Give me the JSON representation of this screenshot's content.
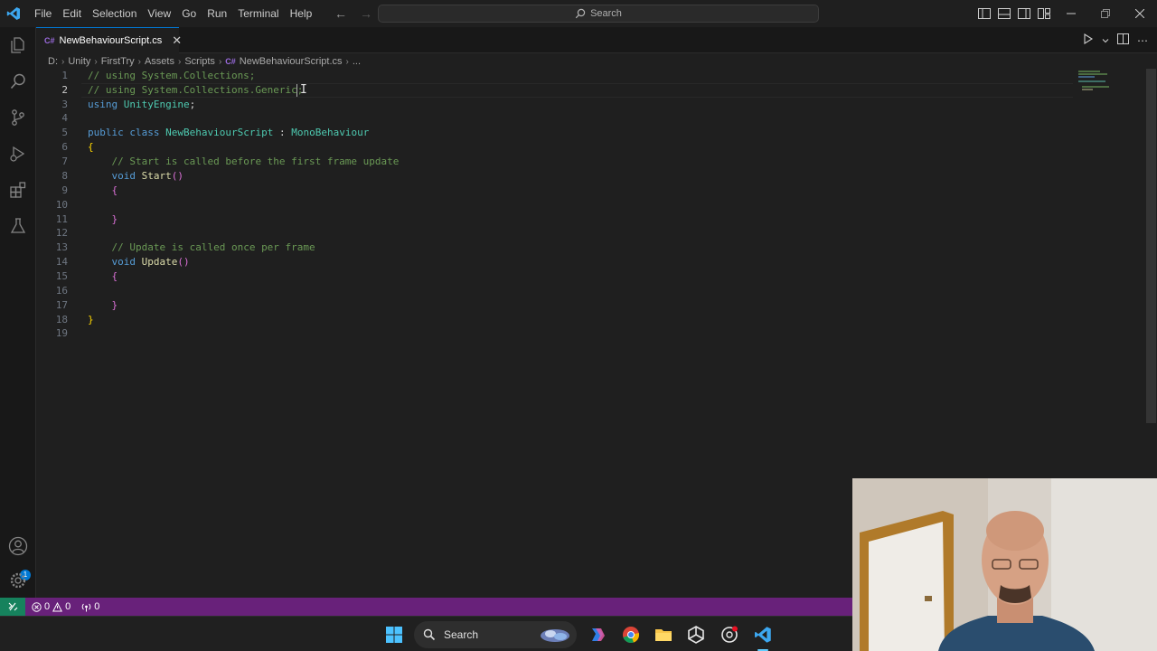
{
  "menu": [
    "File",
    "Edit",
    "Selection",
    "View",
    "Go",
    "Run",
    "Terminal",
    "Help"
  ],
  "command_center": {
    "placeholder": "Search"
  },
  "tab": {
    "lang": "C#",
    "label": "NewBehaviourScript.cs"
  },
  "breadcrumb": {
    "items": [
      "D:",
      "Unity",
      "FirstTry",
      "Assets",
      "Scripts"
    ],
    "file_lang": "C#",
    "file": "NewBehaviourScript.cs",
    "more": "..."
  },
  "editor": {
    "active_line": 2,
    "line_numbers": [
      "1",
      "2",
      "3",
      "4",
      "5",
      "6",
      "7",
      "8",
      "9",
      "10",
      "11",
      "12",
      "13",
      "14",
      "15",
      "16",
      "17",
      "18",
      "19"
    ],
    "code": {
      "l1": "// using System.Collections;",
      "l2": "// using System.Collections.Generic;",
      "l3_kw": "using",
      "l3_ns": "UnityEngine",
      "l3_end": ";",
      "l5_kw1": "public",
      "l5_kw2": "class",
      "l5_name": "NewBehaviourScript",
      "l5_colon": " : ",
      "l5_base": "MonoBehaviour",
      "l6": "{",
      "l7": "// Start is called before the first frame update",
      "l8_kw": "void",
      "l8_fn": "Start",
      "l8_par": "()",
      "l9": "{",
      "l11": "}",
      "l13": "// Update is called once per frame",
      "l14_kw": "void",
      "l14_fn": "Update",
      "l14_par": "()",
      "l15": "{",
      "l17": "}",
      "l18": "}"
    }
  },
  "statusbar": {
    "errors": "0",
    "warnings": "0",
    "ports": "0"
  },
  "activity": {
    "account_badge": "1"
  },
  "taskbar": {
    "search_label": "Search"
  },
  "colors": {
    "statusbar_bg": "#68217a",
    "remote_bg": "#16825d",
    "accent": "#0078d4",
    "comment": "#6a9955",
    "keyword": "#569cd6",
    "type": "#4ec9b0",
    "function": "#dcdcaa"
  },
  "icons": {
    "activity": [
      "explorer-icon",
      "search-icon",
      "source-control-icon",
      "run-debug-icon",
      "extensions-icon",
      "testing-icon",
      "account-icon",
      "manage-gear-icon"
    ],
    "taskbar": [
      "windows-start-icon",
      "search-icon",
      "copilot-icon",
      "chrome-icon",
      "file-explorer-icon",
      "unity-icon",
      "unity-hub-icon",
      "vscode-icon"
    ]
  }
}
